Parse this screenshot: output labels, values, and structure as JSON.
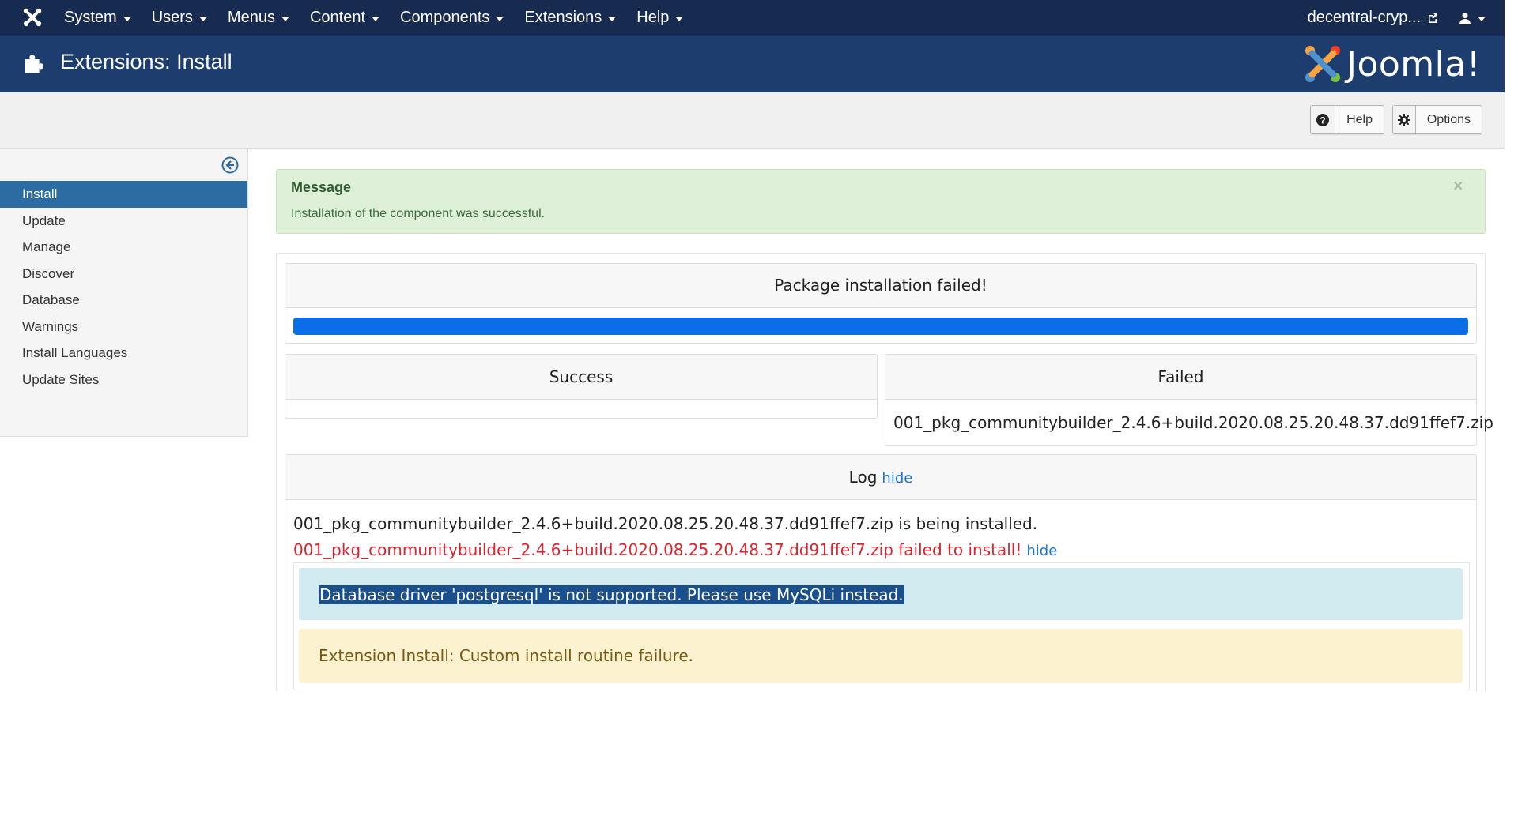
{
  "navbar": {
    "logo_icon": "joomla-icon",
    "menu": [
      {
        "label": "System"
      },
      {
        "label": "Users"
      },
      {
        "label": "Menus"
      },
      {
        "label": "Content"
      },
      {
        "label": "Components"
      },
      {
        "label": "Extensions"
      },
      {
        "label": "Help"
      }
    ],
    "site_name": "decentral-cryp...",
    "user_icon": "user-icon"
  },
  "header": {
    "title": "Extensions: Install",
    "icon": "puzzle-icon",
    "brand": "Joomla!"
  },
  "toolbar": {
    "help_label": "Help",
    "options_label": "Options"
  },
  "sidebar": {
    "items": [
      {
        "label": "Install",
        "active": true
      },
      {
        "label": "Update"
      },
      {
        "label": "Manage"
      },
      {
        "label": "Discover"
      },
      {
        "label": "Database"
      },
      {
        "label": "Warnings"
      },
      {
        "label": "Install Languages"
      },
      {
        "label": "Update Sites"
      }
    ]
  },
  "message": {
    "heading": "Message",
    "text": "Installation of the component was successful.",
    "close": "×"
  },
  "package": {
    "status": "Package installation failed!",
    "progress": 100
  },
  "results": {
    "success_label": "Success",
    "failed_label": "Failed",
    "failed_file": "001_pkg_communitybuilder_2.4.6+build.2020.08.25.20.48.37.dd91ffef7.zip"
  },
  "log": {
    "label": "Log",
    "hide": "hide",
    "line1": "001_pkg_communitybuilder_2.4.6+build.2020.08.25.20.48.37.dd91ffef7.zip is being installed.",
    "line2": "001_pkg_communitybuilder_2.4.6+build.2020.08.25.20.48.37.dd91ffef7.zip failed to install!",
    "line2_hide": "hide",
    "info": "Database driver 'postgresql' is not supported. Please use MySQLi instead.",
    "warning": "Extension Install: Custom install routine failure."
  },
  "colors": {
    "navbar": "#172b50",
    "header": "#1c3d6e",
    "active_item": "#2d6ca2",
    "progress": "#0b6ee8",
    "error_text": "#d9252f"
  }
}
